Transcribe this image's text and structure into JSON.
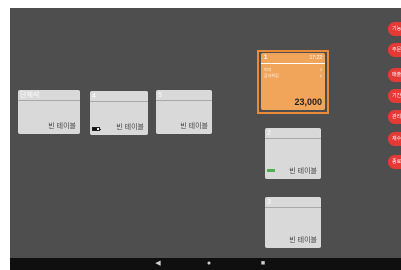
{
  "tables": {
    "danchesik": {
      "name": "단체석",
      "status": "빈 테이블"
    },
    "t4": {
      "name": "4",
      "status": "빈 테이블"
    },
    "t5": {
      "name": "5",
      "status": "빈 테이블"
    },
    "t2": {
      "name": "2",
      "status": "빈 테이블"
    },
    "t3": {
      "name": "3",
      "status": "빈 테이블"
    }
  },
  "order_card": {
    "table_name": "1",
    "time": "17:22",
    "items": [
      {
        "name": "피자",
        "qty": "2"
      },
      {
        "name": "감자튀김",
        "qty": "1"
      }
    ],
    "total": "23,000",
    "colors": {
      "card": "#f0a55a",
      "highlight": "#e98a38"
    }
  },
  "side_menu": {
    "items": [
      {
        "label": "기능"
      },
      {
        "label": "주문"
      },
      {
        "label": "매출"
      },
      {
        "label": "기간"
      },
      {
        "label": "관리"
      },
      {
        "label": "재수"
      },
      {
        "label": "종료"
      }
    ],
    "color": "#e53935"
  },
  "navbar": {
    "back": "◀",
    "home": "●",
    "recent": "■"
  },
  "colors": {
    "background": "#4e4e4e",
    "card": "#d9d9d9",
    "indicator": "#4fb04f"
  }
}
